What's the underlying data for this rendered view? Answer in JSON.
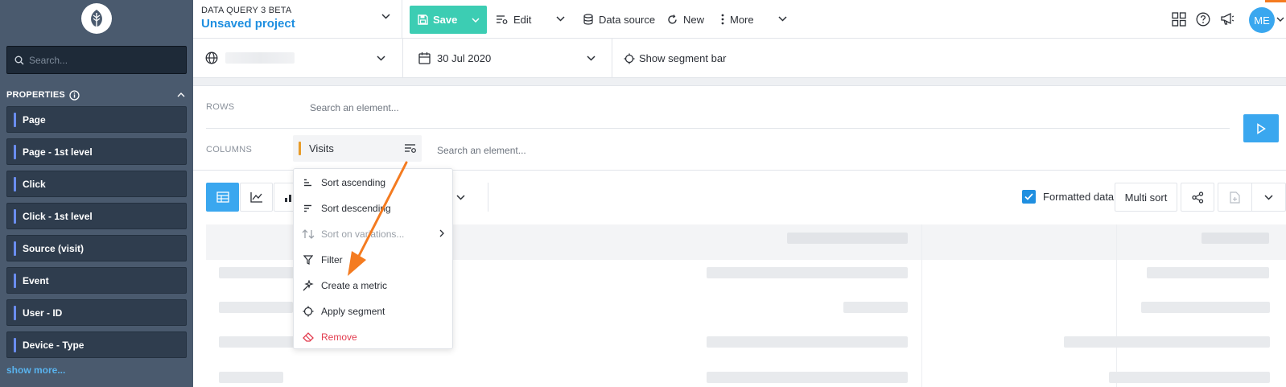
{
  "sidebar": {
    "search_placeholder": "Search...",
    "properties_title": "PROPERTIES",
    "items": [
      {
        "label": "Page"
      },
      {
        "label": "Page - 1st level"
      },
      {
        "label": "Click"
      },
      {
        "label": "Click - 1st level"
      },
      {
        "label": "Source (visit)"
      },
      {
        "label": "Event"
      },
      {
        "label": "User - ID"
      },
      {
        "label": "Device - Type"
      }
    ],
    "show_more": "show more..."
  },
  "header": {
    "subtitle": "DATA QUERY 3 BETA",
    "project_title": "Unsaved project",
    "save_label": "Save",
    "edit_label": "Edit",
    "datasource_label": "Data source",
    "new_label": "New",
    "more_label": "More",
    "avatar_initials": "ME"
  },
  "toolbar2": {
    "date": "30 Jul 2020",
    "segment_bar": "Show segment bar"
  },
  "query": {
    "rows_label": "ROWS",
    "rows_placeholder": "Search an element...",
    "columns_label": "COLUMNS",
    "column_chip": "Visits",
    "columns_placeholder": "Search an element..."
  },
  "viz": {
    "formatted_data": "Formatted data",
    "multi_sort": "Multi sort"
  },
  "menu": {
    "items": [
      {
        "label": "Sort ascending",
        "state": "normal"
      },
      {
        "label": "Sort descending",
        "state": "normal"
      },
      {
        "label": "Sort on variations...",
        "state": "disabled"
      },
      {
        "label": "Filter",
        "state": "normal"
      },
      {
        "label": "Create a metric",
        "state": "normal"
      },
      {
        "label": "Apply segment",
        "state": "normal"
      },
      {
        "label": "Remove",
        "state": "danger"
      }
    ]
  },
  "colors": {
    "sidebar_bg": "#4a5a6e",
    "accent_blue": "#3aa7ef",
    "save_green": "#3ccdb3",
    "annotation_arrow": "#f47b20",
    "danger": "#e23b4e"
  }
}
